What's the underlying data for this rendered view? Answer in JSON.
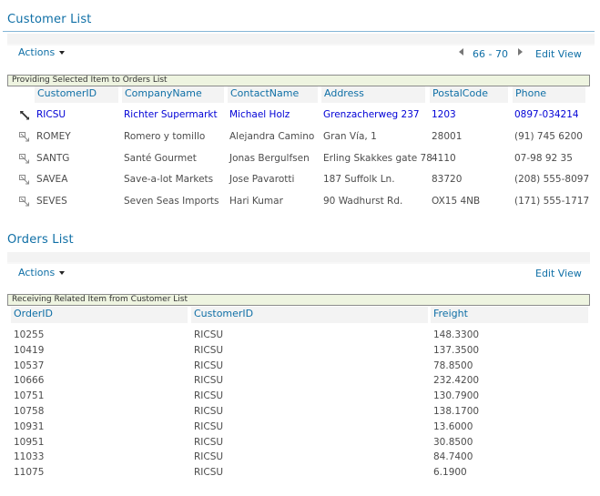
{
  "customer_part": {
    "title": "Customer List",
    "actions_label": "Actions",
    "pager": {
      "range": "66 - 70",
      "prev": "prev-page",
      "next": "next-page"
    },
    "edit_view_label": "Edit View",
    "connection_label": "Providing Selected Item to Orders List",
    "columns": [
      "CustomerID",
      "CompanyName",
      "ContactName",
      "Address",
      "PostalCode",
      "Phone"
    ],
    "rows": [
      {
        "selected": true,
        "icon": "select-item-icon",
        "cells": [
          "RICSU",
          "Richter Supermarkt",
          "Michael Holz",
          "Grenzacherweg 237",
          "1203",
          "0897-034214"
        ]
      },
      {
        "selected": false,
        "icon": "select-item-icon",
        "cells": [
          "ROMEY",
          "Romero y tomillo",
          "Alejandra Camino",
          "Gran Vía, 1",
          "28001",
          "(91) 745 6200"
        ]
      },
      {
        "selected": false,
        "icon": "select-item-icon",
        "cells": [
          "SANTG",
          "Santé Gourmet",
          "Jonas Bergulfsen",
          "Erling Skakkes gate 78",
          "4110",
          "07-98 92 35"
        ]
      },
      {
        "selected": false,
        "icon": "select-item-icon",
        "cells": [
          "SAVEA",
          "Save-a-lot Markets",
          "Jose Pavarotti",
          "187 Suffolk Ln.",
          "83720",
          "(208) 555-8097"
        ]
      },
      {
        "selected": false,
        "icon": "select-item-icon",
        "cells": [
          "SEVES",
          "Seven Seas Imports",
          "Hari Kumar",
          "90 Wadhurst Rd.",
          "OX15 4NB",
          "(171) 555-1717"
        ]
      }
    ]
  },
  "orders_part": {
    "title": "Orders List",
    "actions_label": "Actions",
    "edit_view_label": "Edit View",
    "connection_label": "Receiving Related Item from Customer List",
    "columns": [
      "OrderID",
      "CustomerID",
      "Freight"
    ],
    "rows": [
      [
        "10255",
        "RICSU",
        "148.3300"
      ],
      [
        "10419",
        "RICSU",
        "137.3500"
      ],
      [
        "10537",
        "RICSU",
        "78.8500"
      ],
      [
        "10666",
        "RICSU",
        "232.4200"
      ],
      [
        "10751",
        "RICSU",
        "130.7900"
      ],
      [
        "10758",
        "RICSU",
        "138.1700"
      ],
      [
        "10931",
        "RICSU",
        "13.6000"
      ],
      [
        "10951",
        "RICSU",
        "30.8500"
      ],
      [
        "11033",
        "RICSU",
        "84.7400"
      ],
      [
        "11075",
        "RICSU",
        "6.1900"
      ]
    ]
  },
  "colors": {
    "link": "#0f6fa6",
    "selected_row": "#0000d6",
    "connection_bar": "#eef4e0",
    "header_bg": "#f3f3f3"
  }
}
